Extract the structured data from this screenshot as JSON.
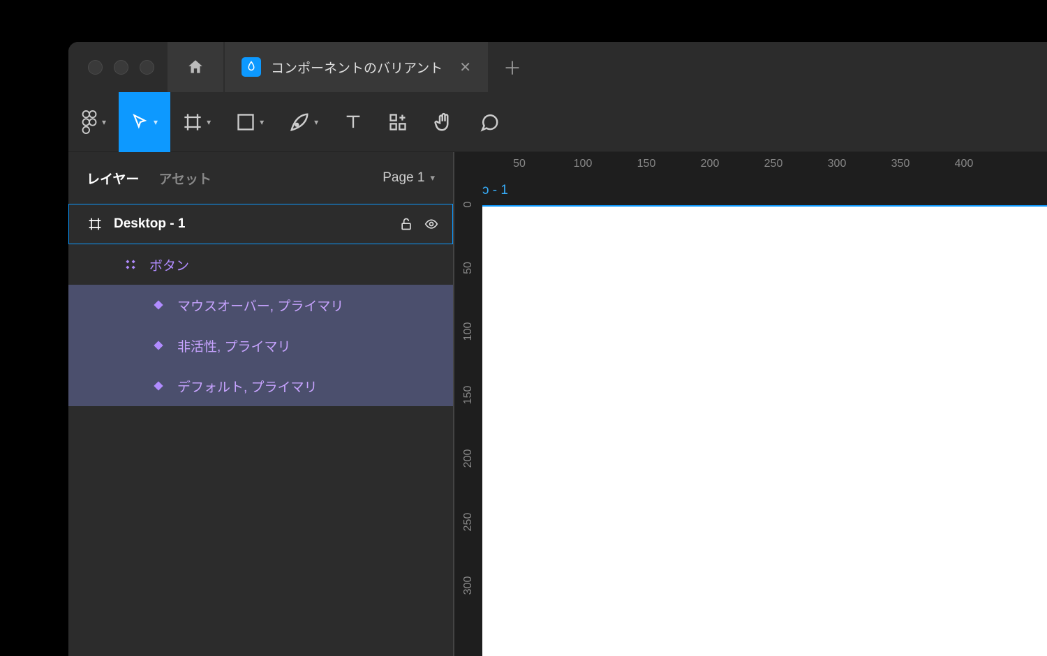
{
  "tab": {
    "file_name": "コンポーネントのバリアント"
  },
  "sidebar": {
    "tabs": {
      "layers": "レイヤー",
      "assets": "アセット"
    },
    "page_label": "Page 1"
  },
  "layers": {
    "frame": "Desktop - 1",
    "component_set": "ボタン",
    "variants": [
      "マウスオーバー, プライマリ",
      "非活性, プライマリ",
      "デフォルト, プライマリ"
    ]
  },
  "canvas": {
    "frame_label_fragment": "ɔ - 1",
    "ruler_x": [
      "50",
      "100",
      "150",
      "200",
      "250",
      "300",
      "350",
      "400"
    ],
    "ruler_y": [
      "0",
      "50",
      "100",
      "150",
      "200",
      "250",
      "300"
    ]
  }
}
